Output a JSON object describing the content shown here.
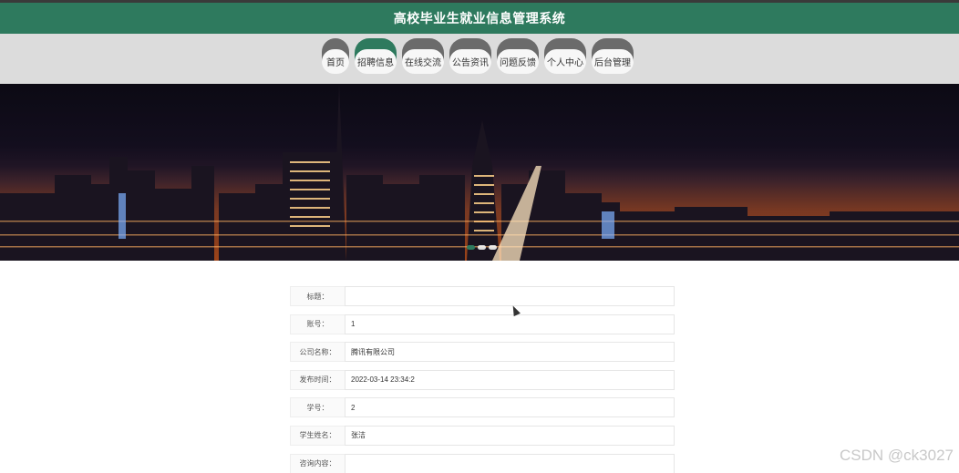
{
  "header": {
    "title": "高校毕业生就业信息管理系统"
  },
  "nav": {
    "items": [
      {
        "label": "首页"
      },
      {
        "label": "招聘信息"
      },
      {
        "label": "在线交流"
      },
      {
        "label": "公告资讯"
      },
      {
        "label": "问题反馈"
      },
      {
        "label": "个人中心"
      },
      {
        "label": "后台管理"
      }
    ]
  },
  "form": {
    "fields": [
      {
        "label": "标题：",
        "value": ""
      },
      {
        "label": "账号：",
        "value": "1"
      },
      {
        "label": "公司名称：",
        "value": "腾讯有限公司"
      },
      {
        "label": "发布时间：",
        "value": "2022-03-14 23:34:2"
      },
      {
        "label": "学号：",
        "value": "2"
      },
      {
        "label": "学生姓名：",
        "value": "张洁"
      },
      {
        "label": "咨询内容：",
        "value": ""
      }
    ]
  },
  "watermark": "CSDN @ck3027",
  "colors": {
    "brand": "#2e7a5e",
    "nav_bg": "#dcdcdc",
    "tab_cap": "#6b6b6b"
  }
}
